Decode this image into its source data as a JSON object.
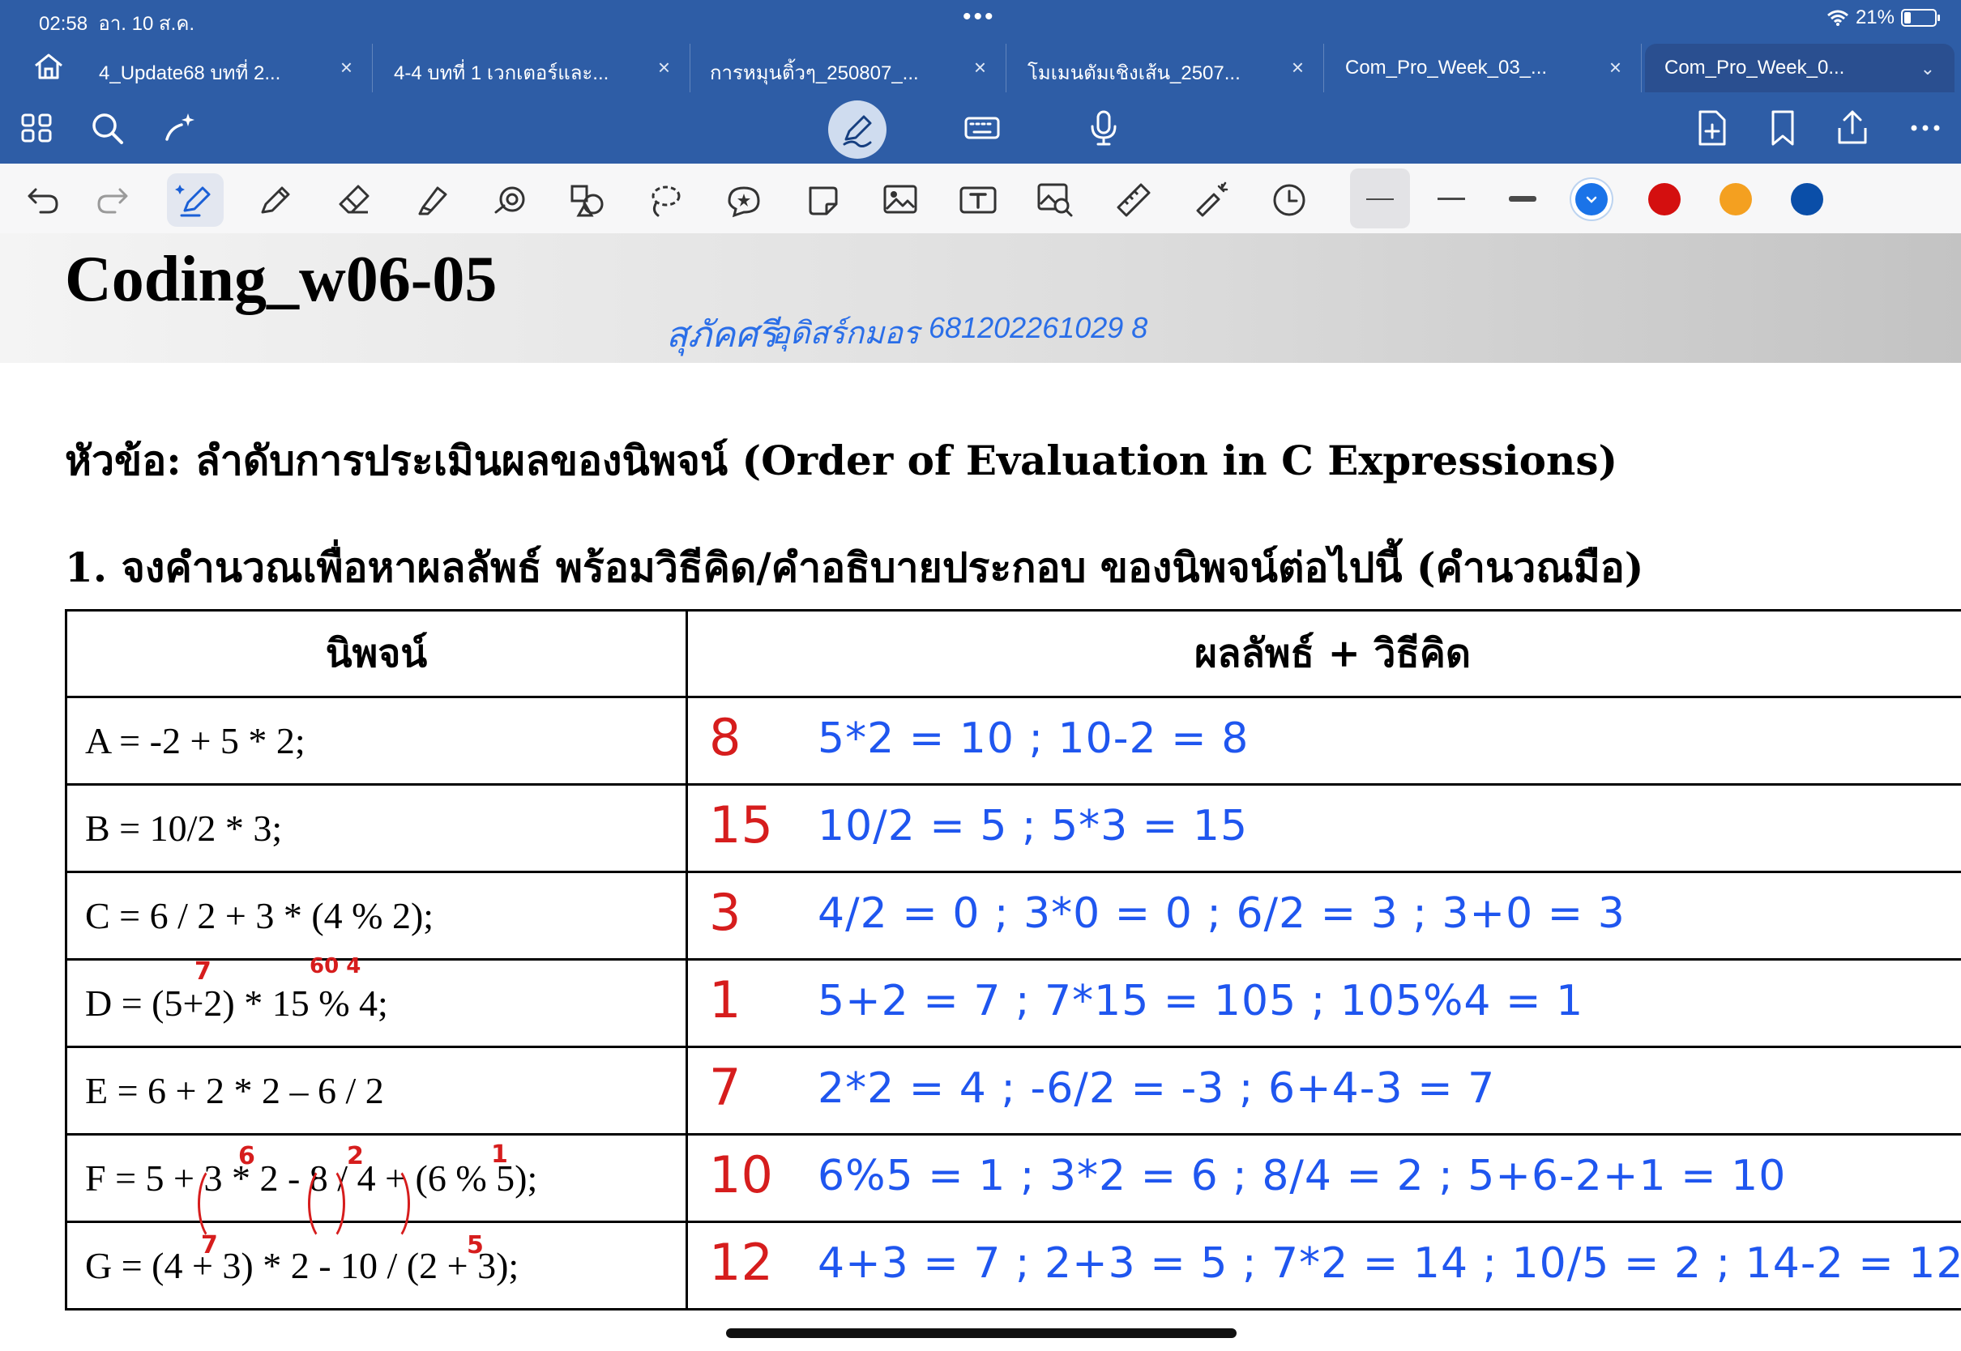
{
  "status_bar": {
    "time": "02:58",
    "date": "อา. 10 ส.ค.",
    "battery_percent": "21%",
    "battery_level": 0.21
  },
  "tabs": [
    {
      "label": "4_Update68 บทที่ 2...",
      "active": false
    },
    {
      "label": "4-4 บทที่ 1 เวกเตอร์และ...",
      "active": false
    },
    {
      "label": "การหมุนติ้วๆ_250807_...",
      "active": false
    },
    {
      "label": "โมเมนตัมเชิงเส้น_2507...",
      "active": false
    },
    {
      "label": "Com_Pro_Week_03_...",
      "active": false
    },
    {
      "label": "Com_Pro_Week_0...",
      "active": true
    }
  ],
  "app_toolbar": {
    "left_icons": [
      "grid-icon",
      "search-icon",
      "magic-wand-icon"
    ],
    "center_icons": [
      "pen-mode-icon",
      "keyboard-icon",
      "microphone-icon"
    ],
    "right_icons": [
      "add-page-icon",
      "bookmark-icon",
      "share-icon",
      "more-icon"
    ]
  },
  "draw_toolbar": {
    "tools": [
      "undo-icon",
      "redo-icon",
      "ai-pen-icon",
      "pencil-icon",
      "eraser-icon",
      "highlighter-icon",
      "shape-recognition-icon",
      "shapes-icon",
      "lasso-icon",
      "sticker-icon",
      "sticky-note-icon",
      "image-icon",
      "text-box-icon",
      "image-search-icon",
      "ruler-icon",
      "laser-pointer-icon",
      "history-icon"
    ],
    "colors": [
      "#1a73e8",
      "#d40f0f",
      "#f4a020",
      "#0a4ea8"
    ],
    "selected_color": "#1a73e8"
  },
  "document": {
    "title": "Coding_w06-05",
    "handwritten_name": {
      "first": "สุภัคศรี",
      "last": "อุดิสร์กมอร",
      "student_id": "681202261029 8"
    },
    "topic": "หัวข้อ: ลำดับการประเมินผลของนิพจน์ (Order of Evaluation in C Expressions)",
    "question": "1. จงคำนวณเพื่อหาผลลัพธ์ พร้อมวิธีคิด/คำอธิบายประกอบ ของนิพจน์ต่อไปนี้ (คำนวณมือ)",
    "table": {
      "headers": [
        "นิพจน์",
        "ผลลัพธ์ + วิธีคิด"
      ],
      "rows": [
        {
          "expression": "A = -2 + 5 * 2;",
          "answer": "8",
          "work": "5*2 = 10 ; 10-2 = 8"
        },
        {
          "expression": "B = 10/2 * 3;",
          "answer": "15",
          "work": "10/2 = 5 ; 5*3 = 15"
        },
        {
          "expression": "C = 6 / 2 + 3 * (4 % 2);",
          "answer": "3",
          "work": "4/2 = 0 ; 3*0 = 0 ; 6/2 = 3 ; 3+0 = 3"
        },
        {
          "expression": "D = (5+2) * 15 % 4;",
          "answer": "1",
          "work": "5+2 = 7 ; 7*15 = 105 ; 105%4 = 1"
        },
        {
          "expression": "E = 6 + 2 * 2 – 6 / 2",
          "answer": "7",
          "work": "2*2 = 4 ; -6/2 = -3 ; 6+4-3 = 7"
        },
        {
          "expression": "F = 5 + 3 * 2 - 8 / 4 + (6 % 5);",
          "answer": "10",
          "work": "6%5 = 1 ; 3*2 = 6 ; 8/4 = 2 ; 5+6-2+1 = 10"
        },
        {
          "expression": "G = (4 + 3) * 2 - 10 / (2 + 3);",
          "answer": "12",
          "work": "4+3 = 7 ; 2+3 = 5 ; 7*2 = 14 ; 10/5 = 2 ; 14-2 = 12"
        }
      ]
    },
    "margin_notes": {
      "d_sum": "7",
      "d_product": "60 4",
      "f_product": "6",
      "f_quotient": "2",
      "f_mod": "1",
      "g_sum_left": "7",
      "g_sum_right": "5"
    }
  }
}
